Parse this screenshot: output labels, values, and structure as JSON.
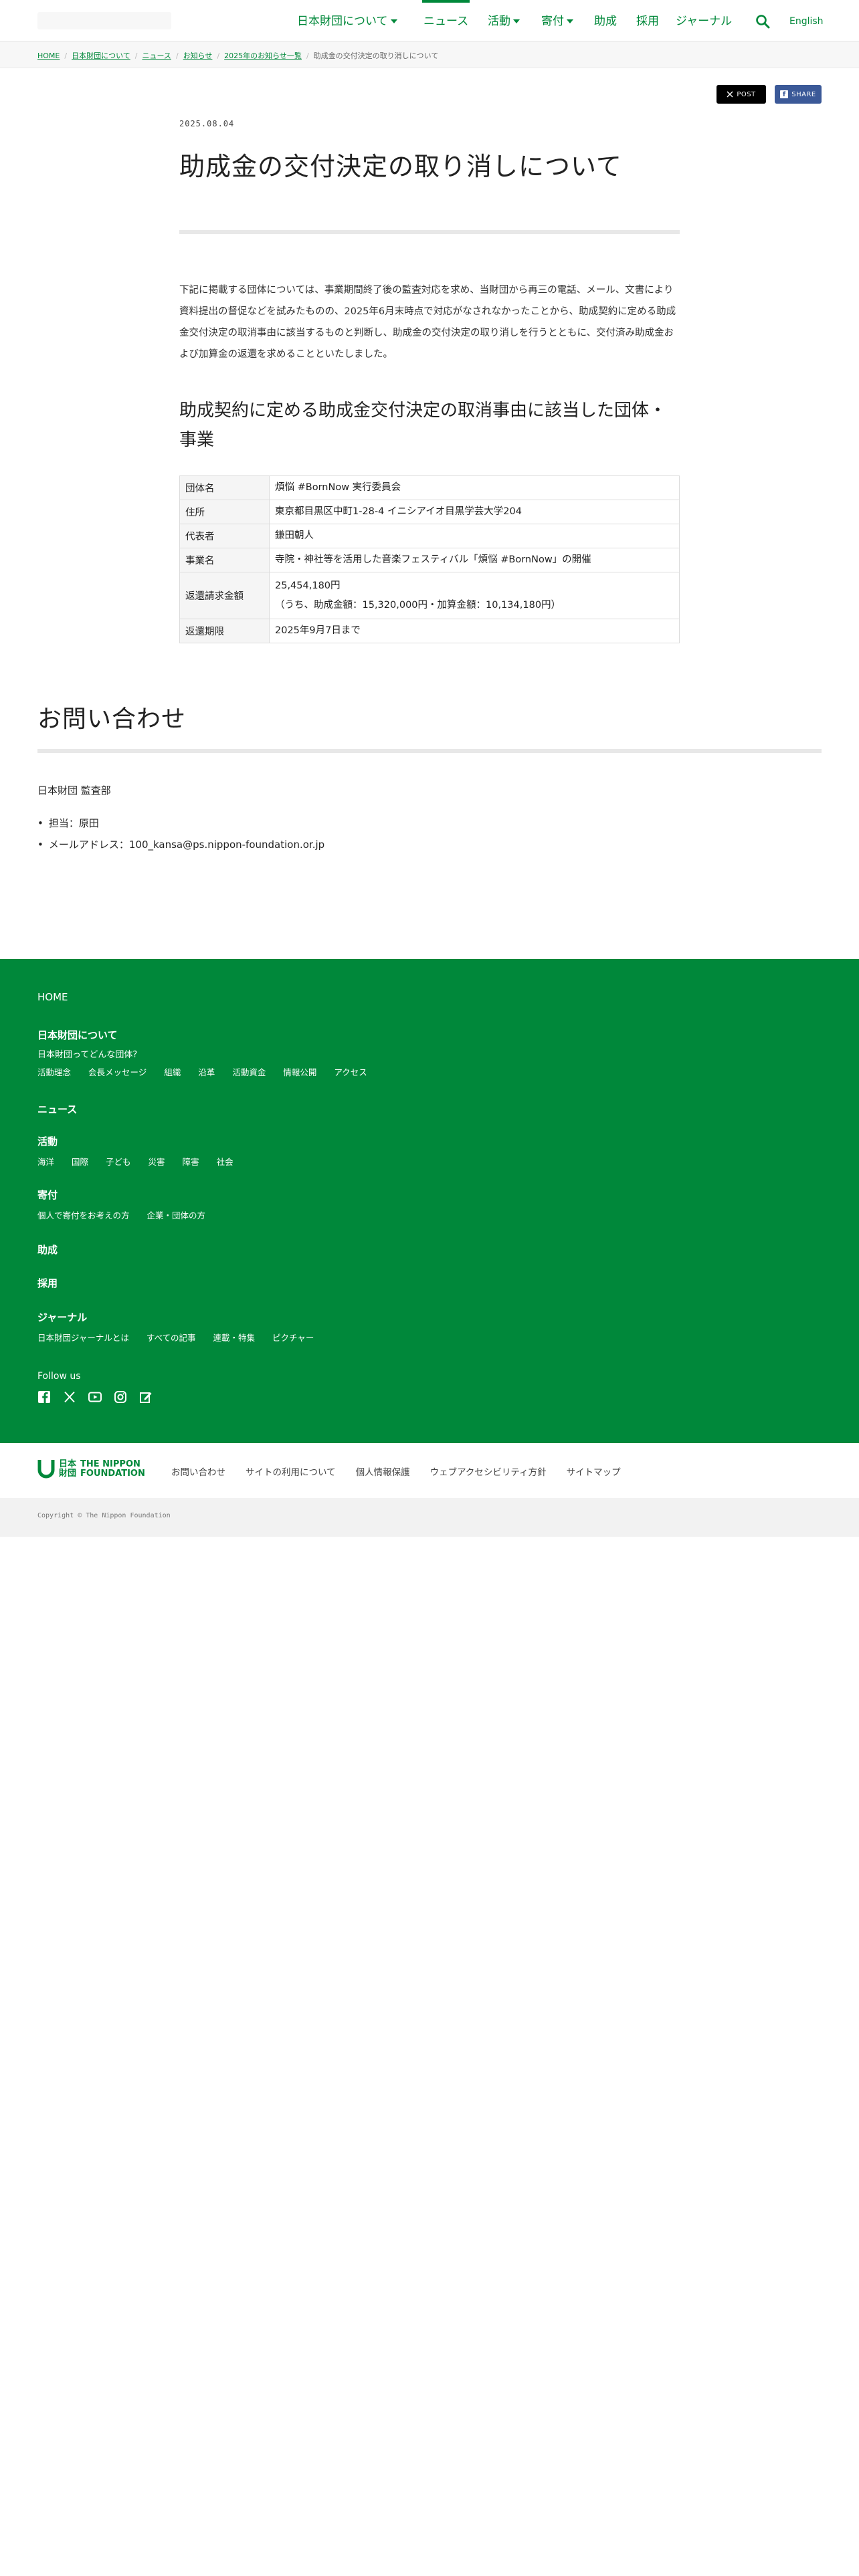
{
  "header": {
    "nav": [
      {
        "label": "日本財団について",
        "dropdown": true,
        "active": false
      },
      {
        "label": "ニュース",
        "dropdown": false,
        "active": true
      },
      {
        "label": "活動",
        "dropdown": true,
        "active": false
      },
      {
        "label": "寄付",
        "dropdown": true,
        "active": false
      },
      {
        "label": "助成",
        "dropdown": false,
        "active": false
      },
      {
        "label": "採用",
        "dropdown": false,
        "active": false
      },
      {
        "label": "ジャーナル",
        "dropdown": false,
        "active": false
      }
    ],
    "search_icon": "search-icon",
    "language_label": "English",
    "accent_color": "#00883a"
  },
  "breadcrumb": [
    {
      "label": "HOME",
      "link": true
    },
    {
      "label": "日本財団について",
      "link": true
    },
    {
      "label": "ニュース",
      "link": true
    },
    {
      "label": "お知らせ",
      "link": true
    },
    {
      "label": "2025年のお知らせ一覧",
      "link": true
    },
    {
      "label": "助成金の交付決定の取り消しについて",
      "link": false
    }
  ],
  "share": {
    "x_label": "POST",
    "fb_label": "SHARE"
  },
  "article": {
    "date": "2025.08.04",
    "title": "助成金の交付決定の取り消しについて",
    "intro": "下記に掲載する団体については、事業期間終了後の監査対応を求め、当財団から再三の電話、メール、文書により資料提出の督促などを試みたものの、2025年6月末時点で対応がなされなかったことから、助成契約に定める助成金交付決定の取消事由に該当するものと判断し、助成金の交付決定の取り消しを行うとともに、交付済み助成金および加算金の返還を求めることといたしました。",
    "section_heading": "助成契約に定める助成金交付決定の取消事由に該当した団体・事業",
    "table": [
      {
        "key": "団体名",
        "values": [
          "煩悩 #BornNow 実行委員会"
        ]
      },
      {
        "key": "住所",
        "values": [
          "東京都目黒区中町1-28-4 イニシアイオ目黒学芸大学204"
        ]
      },
      {
        "key": "代表者",
        "values": [
          "鎌田朝人"
        ]
      },
      {
        "key": "事業名",
        "values": [
          "寺院・神社等を活用した音楽フェスティバル「煩悩 #BornNow」の開催"
        ]
      },
      {
        "key": "返還請求金額",
        "values": [
          "25,454,180円",
          "（うち、助成金額：15,320,000円・加算金額：10,134,180円）"
        ]
      },
      {
        "key": "返還期限",
        "values": [
          "2025年9月7日まで"
        ]
      }
    ]
  },
  "contact": {
    "heading": "お問い合わせ",
    "department": "日本財団 監査部",
    "items": [
      "担当：原田",
      "メールアドレス：100_kansa@ps.nippon-foundation.or.jp"
    ]
  },
  "footer": {
    "background_color": "#00883a",
    "home": "HOME",
    "groups": [
      {
        "title": "日本財団について",
        "sub": "日本財団ってどんな団体?",
        "links": [
          "活動理念",
          "会長メッセージ",
          "組織",
          "沿革",
          "活動資金",
          "情報公開",
          "アクセス"
        ]
      },
      {
        "title": "ニュース",
        "sub": "",
        "links": []
      },
      {
        "title": "活動",
        "sub": "",
        "links": [
          "海洋",
          "国際",
          "子ども",
          "災害",
          "障害",
          "社会"
        ]
      },
      {
        "title": "寄付",
        "sub": "",
        "links": [
          "個人で寄付をお考えの方",
          "企業・団体の方"
        ]
      },
      {
        "title": "助成",
        "sub": "",
        "links": []
      },
      {
        "title": "採用",
        "sub": "",
        "links": []
      },
      {
        "title": "ジャーナル",
        "sub": "",
        "links": [
          "日本財団ジャーナルとは",
          "すべての記事",
          "連載・特集",
          "ピクチャー"
        ]
      }
    ],
    "follow_label": "Follow us",
    "social_icons": [
      "facebook-icon",
      "x-icon",
      "youtube-icon",
      "instagram-icon",
      "note-icon"
    ]
  },
  "bottom": {
    "logo_kanji_top": "日本",
    "logo_kanji_bottom": "財団",
    "logo_en_top": "THE NIPPON",
    "logo_en_bottom": "FOUNDATION",
    "links": [
      "お問い合わせ",
      "サイトの利用について",
      "個人情報保護",
      "ウェブアクセシビリティ方針",
      "サイトマップ"
    ],
    "copyright": "Copyright © The Nippon Foundation"
  }
}
